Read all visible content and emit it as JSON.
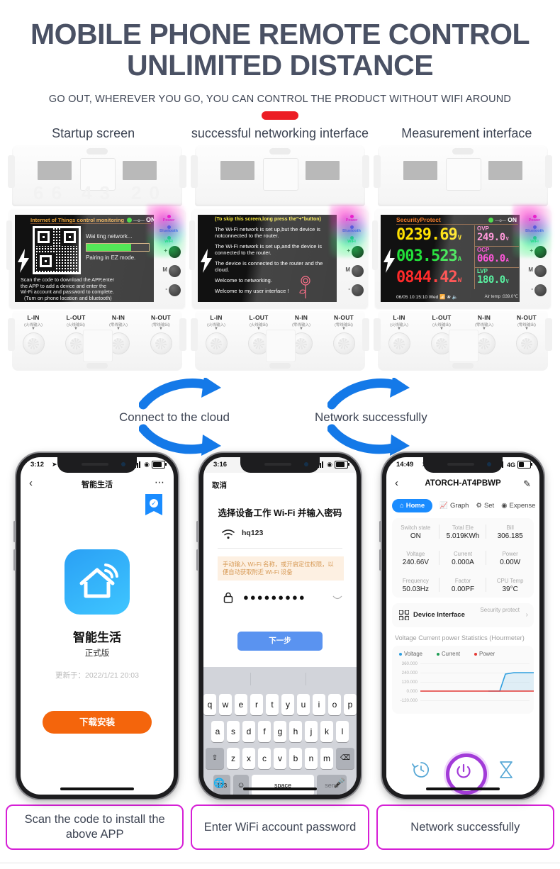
{
  "header": {
    "title_line1": "MOBILE PHONE REMOTE CONTROL",
    "title_line2": "UNLIMITED DISTANCE",
    "subtitle": "GO OUT, WHEREVER YOU GO, YOU CAN CONTROL THE PRODUCT WITHOUT WIFI AROUND",
    "accent_color": "#ec1c24"
  },
  "column_captions": [
    "Startup screen",
    "successful networking interface",
    "Measurement interface"
  ],
  "devices": {
    "leds": [
      {
        "name": "Power",
        "color": "#ff2ad0"
      },
      {
        "name": "Bluetooth",
        "color": "#2a6cff"
      },
      {
        "name": "WiFi",
        "color": "#2aff6c"
      }
    ],
    "buttons": [
      "+",
      "M",
      "-"
    ],
    "terminals": [
      {
        "en": "L-IN",
        "cn": "(火线输入)"
      },
      {
        "en": "L-OUT",
        "cn": "(火线输出)"
      },
      {
        "en": "N-IN",
        "cn": "(零线输入)"
      },
      {
        "en": "N-OUT",
        "cn": "(零线输出)"
      }
    ],
    "startup": {
      "title": "Internet of Things control monitoring",
      "switch_label": "ON",
      "waiting": "Wai ting network...",
      "progress_percent": 72,
      "pairing": "Pairing in EZ mode.",
      "instructions_line1": "Scan the code to download the APP,enter",
      "instructions_line2": "the APP to add a device and enter the",
      "instructions_line3": "Wi-Fi account and password to complete.",
      "instructions_line4": "(Turn on phone location and bluetooth)"
    },
    "networking": {
      "hint": "(To skip this screen,long press the\"+\"button)",
      "lines": [
        "The Wi-Fi network is set up,but the device is notconnected to the router.",
        "The Wi-Fi network is set up,and the device is connected to the router.",
        "The device is connected to the router and the cloud.",
        "Welcome to networking.",
        "Welcome to my user interface !"
      ]
    },
    "measurement": {
      "title": "SecurityProtect",
      "switch_label": "ON",
      "voltage": "0239.69",
      "voltage_unit": "V",
      "current": "003.523",
      "current_unit": "A",
      "power": "0844.42",
      "power_unit": "W",
      "limits": [
        {
          "label": "OVP",
          "value": "249.0",
          "unit": "V"
        },
        {
          "label": "OCP",
          "value": "060.0",
          "unit": "A"
        },
        {
          "label": "LVP",
          "value": "180.0",
          "unit": "V"
        }
      ],
      "date": "06/05",
      "time": "10:15:10",
      "weekday": "Wed",
      "air_temp": "Air temp :039.0℃"
    }
  },
  "arrows": {
    "label_left": "Connect to the cloud",
    "label_right": "Network successfully",
    "color": "#1479e8"
  },
  "phone1": {
    "status_time": "3:12",
    "nav_title": "智能生活",
    "app_name": "智能生活",
    "version": "正式版",
    "updated": "更新于：2022/1/21 20:03",
    "download_button": "下载安装"
  },
  "phone2": {
    "status_time": "3:16",
    "cancel": "取消",
    "heading": "选择设备工作 Wi-Fi 并输入密码",
    "wifi_name": "hq123",
    "tip": "手动输入 Wi-Fi 名称，或开启定位权限，以便自动获取附近 Wi-Fi 设备",
    "password_masked": "●●●●●●●●●",
    "next_button": "下一步",
    "keyboard": {
      "row1": [
        "q",
        "w",
        "e",
        "r",
        "t",
        "y",
        "u",
        "i",
        "o",
        "p"
      ],
      "row2": [
        "a",
        "s",
        "d",
        "f",
        "g",
        "h",
        "j",
        "k",
        "l"
      ],
      "row3": [
        "z",
        "x",
        "c",
        "v",
        "b",
        "n",
        "m"
      ],
      "shift": "⇧",
      "backspace": "⌫",
      "numbers": "123",
      "emoji": "☺",
      "space": "space",
      "send": "send"
    }
  },
  "phone3": {
    "status_time": "14:49",
    "network_type": "4G",
    "device_name": "ATORCH-AT4PBWP",
    "tabs": [
      {
        "label": "Home",
        "active": true
      },
      {
        "label": "Graph",
        "active": false
      },
      {
        "label": "Set",
        "active": false
      },
      {
        "label": "Expense",
        "active": false
      }
    ],
    "metrics": [
      {
        "key": "Switch state",
        "value": "ON"
      },
      {
        "key": "Total Ele",
        "value": "5.019KWh"
      },
      {
        "key": "Bill",
        "value": "306.185"
      },
      {
        "key": "Voltage",
        "value": "240.66V"
      },
      {
        "key": "Current",
        "value": "0.000A"
      },
      {
        "key": "Power",
        "value": "0.00W"
      },
      {
        "key": "Frequency",
        "value": "50.03Hz"
      },
      {
        "key": "Factor",
        "value": "0.00PF"
      },
      {
        "key": "CPU Temp",
        "value": "39°C"
      }
    ],
    "device_interface_label": "Device Interface",
    "security_protect_label": "Security protect",
    "chart_title": "Voltage Current power Statistics (Hourmeter)"
  },
  "chart_data": {
    "type": "line",
    "title": "Voltage Current power Statistics (Hourmeter)",
    "xlabel": "",
    "ylabel": "",
    "ylim": [
      -120.0,
      360.0
    ],
    "yticks": [
      "360.000",
      "240.000",
      "120.000",
      "0.000",
      "-120.000"
    ],
    "grid": true,
    "legend_position": "top-left",
    "legend": [
      "Voltage",
      "Current",
      "Power"
    ],
    "colors": {
      "Voltage": "#2f9fe0",
      "Current": "#1f9d55",
      "Power": "#e53935"
    },
    "x": [
      0,
      1,
      2,
      3,
      4,
      5,
      6,
      7,
      8,
      9,
      10
    ],
    "series": [
      {
        "name": "Voltage",
        "values": [
          0,
          0,
          0,
          0,
          0,
          0,
          0,
          0,
          120,
          240,
          245
        ]
      },
      {
        "name": "Current",
        "values": [
          0,
          0,
          0,
          0,
          0,
          0,
          0,
          0,
          0,
          0,
          0
        ]
      },
      {
        "name": "Power",
        "values": [
          0,
          0,
          0,
          0,
          0,
          0,
          0,
          0,
          0,
          0,
          0
        ]
      }
    ]
  },
  "captions": [
    "Scan the code to install the above APP",
    "Enter WiFi account password",
    "Network successfully"
  ]
}
